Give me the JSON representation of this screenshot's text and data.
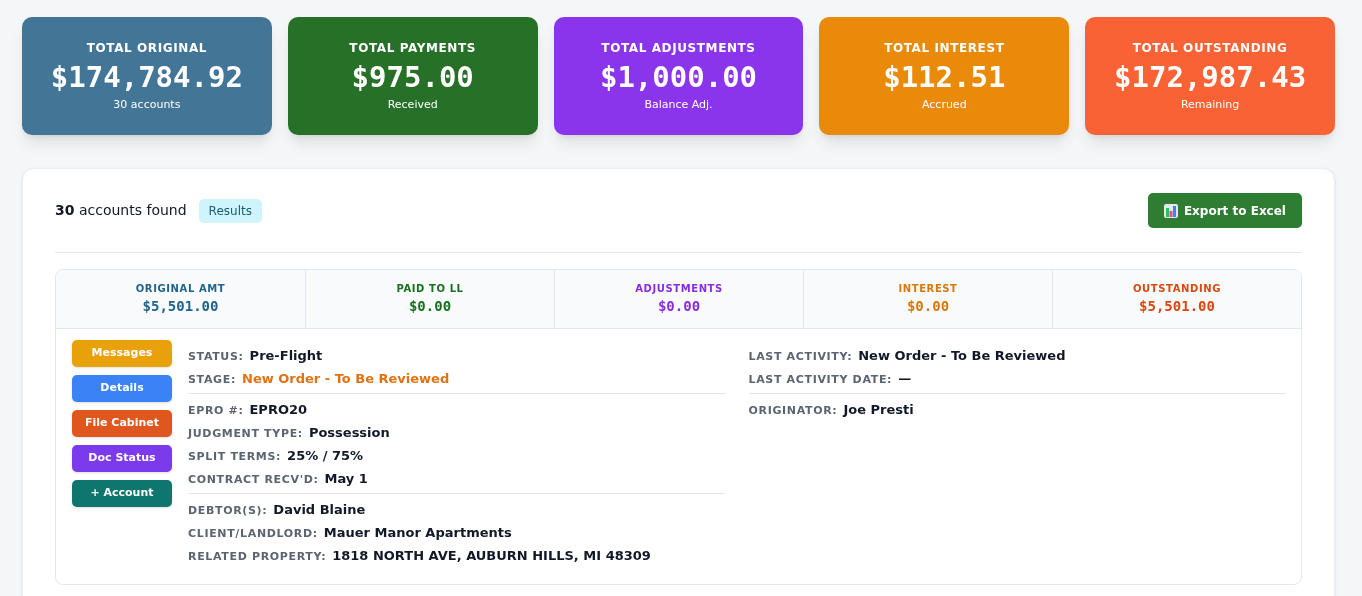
{
  "summary_cards": [
    {
      "title": "TOTAL ORIGINAL",
      "value": "$174,784.92",
      "caption": "30 accounts",
      "color": "#437596"
    },
    {
      "title": "TOTAL PAYMENTS",
      "value": "$975.00",
      "caption": "Received",
      "color": "#267127"
    },
    {
      "title": "TOTAL ADJUSTMENTS",
      "value": "$1,000.00",
      "caption": "Balance Adj.",
      "color": "#8a35eb"
    },
    {
      "title": "TOTAL INTEREST",
      "value": "$112.51",
      "caption": "Accrued",
      "color": "#e98a0a"
    },
    {
      "title": "TOTAL OUTSTANDING",
      "value": "$172,987.43",
      "caption": "Remaining",
      "color": "#f96235"
    }
  ],
  "results": {
    "count": "30",
    "label": "accounts found",
    "badge": "Results",
    "export_button": "Export to Excel"
  },
  "account": {
    "metrics": [
      {
        "label": "ORIGINAL AMT",
        "value": "$5,501.00",
        "color": "#21638c"
      },
      {
        "label": "PAID TO LL",
        "value": "$0.00",
        "color": "#17701f"
      },
      {
        "label": "ADJUSTMENTS",
        "value": "$0.00",
        "color": "#8a2be2"
      },
      {
        "label": "INTEREST",
        "value": "$0.00",
        "color": "#d97706"
      },
      {
        "label": "OUTSTANDING",
        "value": "$5,501.00",
        "color": "#d9480f"
      }
    ],
    "actions": [
      {
        "label": "Messages",
        "color": "#e8a10a"
      },
      {
        "label": "Details",
        "color": "#3b82f6"
      },
      {
        "label": "File Cabinet",
        "color": "#e0561f"
      },
      {
        "label": "Doc Status",
        "color": "#7c3aed"
      },
      {
        "label": "+ Account",
        "color": "#0f766e"
      }
    ],
    "left_groups": [
      [
        {
          "label": "STATUS:",
          "value": "Pre-Flight",
          "highlight": false
        },
        {
          "label": "STAGE:",
          "value": "New Order - To Be Reviewed",
          "highlight": true
        }
      ],
      [
        {
          "label": "EPRO #:",
          "value": "EPRO20",
          "highlight": false
        },
        {
          "label": "JUDGMENT TYPE:",
          "value": "Possession",
          "highlight": false
        },
        {
          "label": "SPLIT TERMS:",
          "value": "25% / 75%",
          "highlight": false
        },
        {
          "label": "CONTRACT RECV'D:",
          "value": "May 1",
          "highlight": false
        }
      ],
      [
        {
          "label": "DEBTOR(S):",
          "value": "David Blaine",
          "highlight": false
        },
        {
          "label": "CLIENT/LANDLORD:",
          "value": "Mauer Manor Apartments",
          "highlight": false
        },
        {
          "label": "RELATED PROPERTY:",
          "value": "1818 NORTH AVE, AUBURN HILLS, MI 48309",
          "highlight": false
        }
      ]
    ],
    "right_groups": [
      [
        {
          "label": "LAST ACTIVITY:",
          "value": "New Order - To Be Reviewed",
          "highlight": false
        },
        {
          "label": "LAST ACTIVITY DATE:",
          "value": "—",
          "highlight": false
        }
      ],
      [
        {
          "label": "ORIGINATOR:",
          "value": "Joe Presti",
          "highlight": false
        }
      ]
    ]
  }
}
